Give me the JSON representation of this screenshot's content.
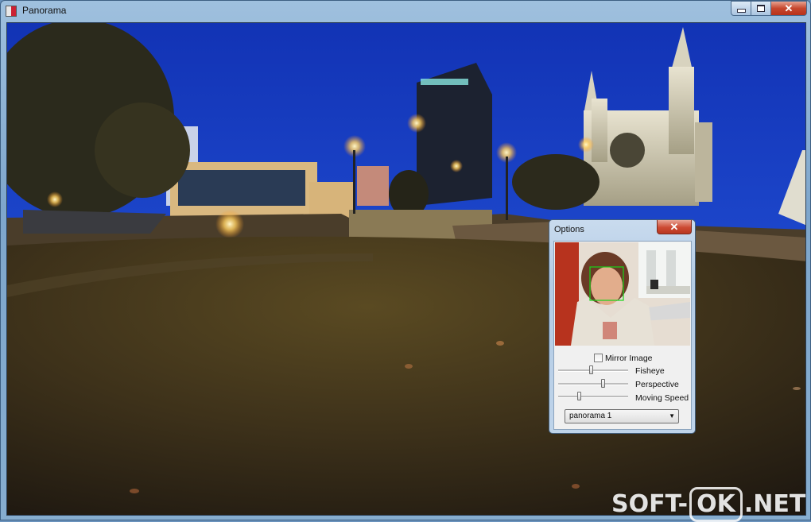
{
  "window": {
    "title": "Panorama",
    "controls": {
      "minimize": "minimize",
      "maximize": "maximize",
      "close": "close"
    }
  },
  "options": {
    "title": "Options",
    "close_glyph": "✕",
    "mirror_label": "Mirror Image",
    "mirror_checked": false,
    "sliders": [
      {
        "label": "Fisheye",
        "value": 0.47
      },
      {
        "label": "Perspective",
        "value": 0.64
      },
      {
        "label": "Moving Speed",
        "value": 0.29
      }
    ],
    "panorama_select": {
      "value": "panorama 1"
    }
  },
  "watermark": {
    "left": "SOFT-",
    "boxed": "OK",
    "right": ".NET"
  },
  "colors": {
    "sky": "#1d3fb5",
    "grass": "#3b3016",
    "titlebar": "#8fb4d8",
    "close": "#c6472e"
  }
}
